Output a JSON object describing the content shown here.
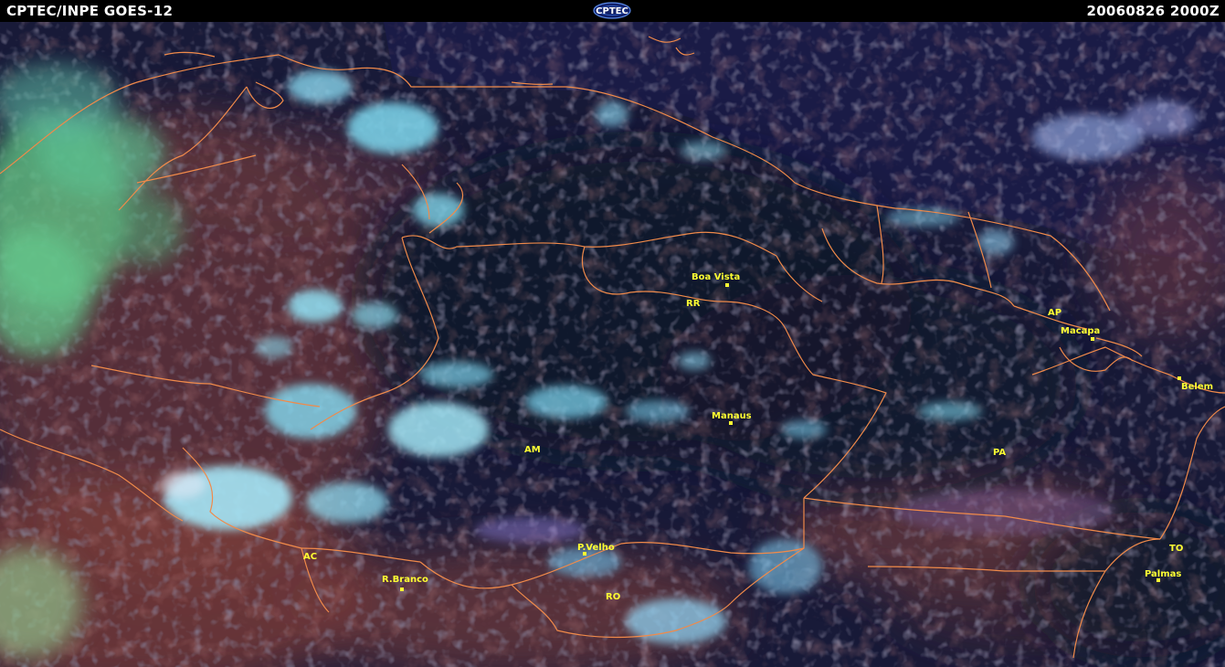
{
  "header": {
    "left_title": "CPTEC/INPE  GOES-12",
    "logo_text": "CPTEC",
    "timestamp": "20060826  2000Z"
  },
  "colors": {
    "header_bg": "#000000",
    "header_text": "#ffffff",
    "background_dark": "#181a38",
    "land_reddish": "#7a3c3a",
    "cloud_cyan": "#6fd6ef",
    "cloud_white": "#e4eaf6",
    "andes_green": "#6fc28a",
    "boundary_orange": "#f08a4a",
    "label_yellow": "#ffff33"
  },
  "map": {
    "cities": [
      {
        "name": "Boa Vista"
      },
      {
        "name": "Macapa"
      },
      {
        "name": "Belem"
      },
      {
        "name": "Manaus"
      },
      {
        "name": "P.Velho"
      },
      {
        "name": "R.Branco"
      },
      {
        "name": "Palmas"
      }
    ],
    "states": [
      {
        "code": "RR"
      },
      {
        "code": "AP"
      },
      {
        "code": "AM"
      },
      {
        "code": "PA"
      },
      {
        "code": "AC"
      },
      {
        "code": "RO"
      },
      {
        "code": "TO"
      }
    ]
  }
}
